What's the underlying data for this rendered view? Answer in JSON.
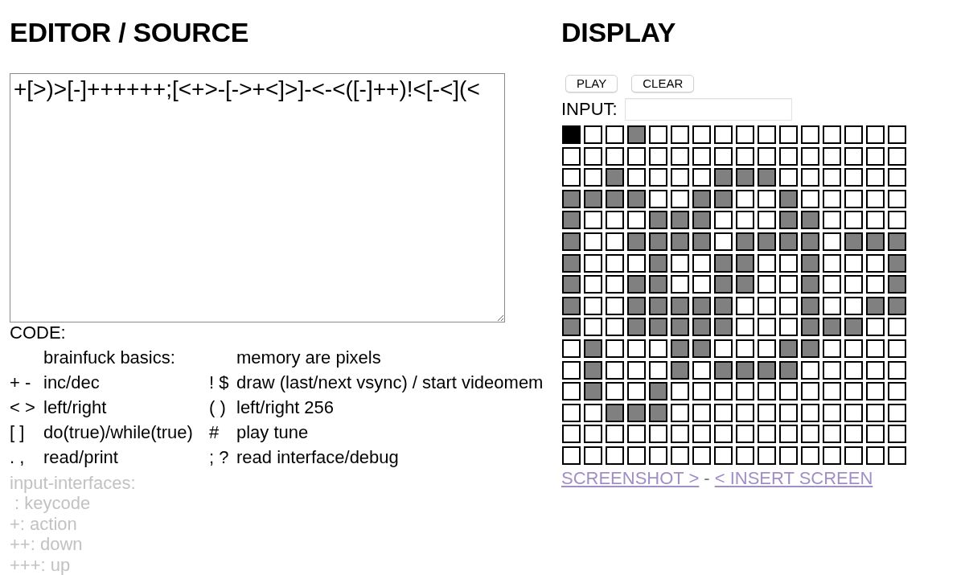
{
  "editor": {
    "title": "EDITOR / SOURCE",
    "source": "+[>)>[-]++++++;[<+>-[->+<]>]-<-<([-]++)!<[-<](<",
    "code_label": "CODE:",
    "reference": [
      {
        "left": {
          "text": "brainfuck basics:"
        },
        "right": {
          "text": "memory are pixels"
        }
      },
      {
        "left": {
          "keys": "+ -",
          "text": "inc/dec"
        },
        "right": {
          "keys": "! $",
          "text": "draw (last/next vsync) / start videomem"
        }
      },
      {
        "left": {
          "keys": "< >",
          "text": "left/right"
        },
        "right": {
          "keys": "( )",
          "text": "left/right 256"
        }
      },
      {
        "left": {
          "keys": "[ ]",
          "text": "do(true)/while(true)"
        },
        "right": {
          "keys": "#",
          "text": "play tune"
        }
      },
      {
        "left": {
          "keys": ". ,",
          "text": "read/print"
        },
        "right": {
          "keys": "; ?",
          "text": "read interface/debug"
        }
      }
    ],
    "input_interfaces": {
      "heading": "input-interfaces:",
      "items": [
        " : keycode",
        "+: action",
        "++: down",
        "+++: up"
      ]
    }
  },
  "display": {
    "title": "DISPLAY",
    "buttons": [
      "PLAY",
      "CLEAR"
    ],
    "input": {
      "label": "INPUT:"
    },
    "pixels": [
      [
        {
          "color": "#000000"
        },
        {
          "color": "#ffffff"
        },
        {
          "color": "#ffffff"
        },
        {
          "color": "#808080"
        },
        {
          "color": "#ffffff"
        },
        {
          "color": "#ffffff"
        },
        {
          "color": "#ffffff"
        },
        {
          "color": "#ffffff"
        },
        {
          "color": "#ffffff"
        },
        {
          "color": "#ffffff"
        },
        {
          "color": "#ffffff"
        },
        {
          "color": "#ffffff"
        },
        {
          "color": "#ffffff"
        },
        {
          "color": "#ffffff"
        },
        {
          "color": "#ffffff"
        },
        {
          "color": "#ffffff"
        }
      ],
      [
        {
          "color": "#ffffff"
        },
        {
          "color": "#ffffff"
        },
        {
          "color": "#ffffff"
        },
        {
          "color": "#ffffff"
        },
        {
          "color": "#ffffff"
        },
        {
          "color": "#ffffff"
        },
        {
          "color": "#ffffff"
        },
        {
          "color": "#ffffff"
        },
        {
          "color": "#ffffff"
        },
        {
          "color": "#ffffff"
        },
        {
          "color": "#ffffff"
        },
        {
          "color": "#ffffff"
        },
        {
          "color": "#ffffff"
        },
        {
          "color": "#ffffff"
        },
        {
          "color": "#ffffff"
        },
        {
          "color": "#ffffff"
        }
      ],
      [
        {
          "color": "#ffffff"
        },
        {
          "color": "#ffffff"
        },
        {
          "color": "#808080"
        },
        {
          "color": "#ffffff"
        },
        {
          "color": "#ffffff"
        },
        {
          "color": "#ffffff"
        },
        {
          "color": "#ffffff"
        },
        {
          "color": "#808080"
        },
        {
          "color": "#808080"
        },
        {
          "color": "#808080"
        },
        {
          "color": "#ffffff"
        },
        {
          "color": "#ffffff"
        },
        {
          "color": "#ffffff"
        },
        {
          "color": "#ffffff"
        },
        {
          "color": "#ffffff"
        },
        {
          "color": "#ffffff"
        }
      ],
      [
        {
          "color": "#808080"
        },
        {
          "color": "#808080"
        },
        {
          "color": "#808080"
        },
        {
          "color": "#808080"
        },
        {
          "color": "#ffffff"
        },
        {
          "color": "#ffffff"
        },
        {
          "color": "#808080"
        },
        {
          "color": "#808080"
        },
        {
          "color": "#ffffff"
        },
        {
          "color": "#ffffff"
        },
        {
          "color": "#808080"
        },
        {
          "color": "#ffffff"
        },
        {
          "color": "#ffffff"
        },
        {
          "color": "#ffffff"
        },
        {
          "color": "#ffffff"
        },
        {
          "color": "#ffffff"
        }
      ],
      [
        {
          "color": "#808080"
        },
        {
          "color": "#ffffff"
        },
        {
          "color": "#ffffff"
        },
        {
          "color": "#ffffff"
        },
        {
          "color": "#808080"
        },
        {
          "color": "#808080"
        },
        {
          "color": "#808080"
        },
        {
          "color": "#ffffff"
        },
        {
          "color": "#ffffff"
        },
        {
          "color": "#ffffff"
        },
        {
          "color": "#808080"
        },
        {
          "color": "#808080"
        },
        {
          "color": "#ffffff"
        },
        {
          "color": "#ffffff"
        },
        {
          "color": "#ffffff"
        },
        {
          "color": "#ffffff"
        }
      ],
      [
        {
          "color": "#808080"
        },
        {
          "color": "#ffffff"
        },
        {
          "color": "#ffffff"
        },
        {
          "color": "#808080"
        },
        {
          "color": "#808080"
        },
        {
          "color": "#808080"
        },
        {
          "color": "#808080"
        },
        {
          "color": "#ffffff"
        },
        {
          "color": "#808080"
        },
        {
          "color": "#808080"
        },
        {
          "color": "#808080"
        },
        {
          "color": "#808080"
        },
        {
          "color": "#ffffff"
        },
        {
          "color": "#808080"
        },
        {
          "color": "#808080"
        },
        {
          "color": "#808080"
        }
      ],
      [
        {
          "color": "#808080"
        },
        {
          "color": "#ffffff"
        },
        {
          "color": "#ffffff"
        },
        {
          "color": "#ffffff"
        },
        {
          "color": "#808080"
        },
        {
          "color": "#ffffff"
        },
        {
          "color": "#ffffff"
        },
        {
          "color": "#808080"
        },
        {
          "color": "#808080"
        },
        {
          "color": "#ffffff"
        },
        {
          "color": "#ffffff"
        },
        {
          "color": "#808080"
        },
        {
          "color": "#ffffff"
        },
        {
          "color": "#ffffff"
        },
        {
          "color": "#ffffff"
        },
        {
          "color": "#808080"
        }
      ],
      [
        {
          "color": "#808080"
        },
        {
          "color": "#ffffff"
        },
        {
          "color": "#ffffff"
        },
        {
          "color": "#808080"
        },
        {
          "color": "#808080"
        },
        {
          "color": "#ffffff"
        },
        {
          "color": "#ffffff"
        },
        {
          "color": "#808080"
        },
        {
          "color": "#808080"
        },
        {
          "color": "#ffffff"
        },
        {
          "color": "#ffffff"
        },
        {
          "color": "#808080"
        },
        {
          "color": "#ffffff"
        },
        {
          "color": "#ffffff"
        },
        {
          "color": "#ffffff"
        },
        {
          "color": "#808080"
        }
      ],
      [
        {
          "color": "#808080"
        },
        {
          "color": "#ffffff"
        },
        {
          "color": "#ffffff"
        },
        {
          "color": "#808080"
        },
        {
          "color": "#808080"
        },
        {
          "color": "#808080"
        },
        {
          "color": "#808080"
        },
        {
          "color": "#808080"
        },
        {
          "color": "#ffffff"
        },
        {
          "color": "#ffffff"
        },
        {
          "color": "#ffffff"
        },
        {
          "color": "#808080"
        },
        {
          "color": "#ffffff"
        },
        {
          "color": "#ffffff"
        },
        {
          "color": "#808080"
        },
        {
          "color": "#808080"
        }
      ],
      [
        {
          "color": "#808080"
        },
        {
          "color": "#ffffff"
        },
        {
          "color": "#ffffff"
        },
        {
          "color": "#808080"
        },
        {
          "color": "#808080"
        },
        {
          "color": "#808080"
        },
        {
          "color": "#808080"
        },
        {
          "color": "#808080"
        },
        {
          "color": "#ffffff"
        },
        {
          "color": "#ffffff"
        },
        {
          "color": "#ffffff"
        },
        {
          "color": "#808080"
        },
        {
          "color": "#808080"
        },
        {
          "color": "#808080"
        },
        {
          "color": "#ffffff"
        },
        {
          "color": "#ffffff"
        }
      ],
      [
        {
          "color": "#ffffff"
        },
        {
          "color": "#808080"
        },
        {
          "color": "#ffffff"
        },
        {
          "color": "#ffffff"
        },
        {
          "color": "#ffffff"
        },
        {
          "color": "#808080"
        },
        {
          "color": "#808080"
        },
        {
          "color": "#ffffff"
        },
        {
          "color": "#ffffff"
        },
        {
          "color": "#ffffff"
        },
        {
          "color": "#808080"
        },
        {
          "color": "#808080"
        },
        {
          "color": "#ffffff"
        },
        {
          "color": "#ffffff"
        },
        {
          "color": "#ffffff"
        },
        {
          "color": "#ffffff"
        }
      ],
      [
        {
          "color": "#ffffff"
        },
        {
          "color": "#808080"
        },
        {
          "color": "#ffffff"
        },
        {
          "color": "#ffffff"
        },
        {
          "color": "#ffffff"
        },
        {
          "color": "#808080"
        },
        {
          "color": "#ffffff"
        },
        {
          "color": "#808080"
        },
        {
          "color": "#808080"
        },
        {
          "color": "#808080"
        },
        {
          "color": "#808080"
        },
        {
          "color": "#ffffff"
        },
        {
          "color": "#ffffff"
        },
        {
          "color": "#ffffff"
        },
        {
          "color": "#ffffff"
        },
        {
          "color": "#ffffff"
        }
      ],
      [
        {
          "color": "#ffffff"
        },
        {
          "color": "#808080"
        },
        {
          "color": "#ffffff"
        },
        {
          "color": "#ffffff"
        },
        {
          "color": "#808080"
        },
        {
          "color": "#ffffff"
        },
        {
          "color": "#ffffff"
        },
        {
          "color": "#ffffff"
        },
        {
          "color": "#ffffff"
        },
        {
          "color": "#ffffff"
        },
        {
          "color": "#ffffff"
        },
        {
          "color": "#ffffff"
        },
        {
          "color": "#ffffff"
        },
        {
          "color": "#ffffff"
        },
        {
          "color": "#ffffff"
        },
        {
          "color": "#ffffff"
        }
      ],
      [
        {
          "color": "#ffffff"
        },
        {
          "color": "#ffffff"
        },
        {
          "color": "#808080"
        },
        {
          "color": "#808080"
        },
        {
          "color": "#808080"
        },
        {
          "color": "#ffffff"
        },
        {
          "color": "#ffffff"
        },
        {
          "color": "#ffffff"
        },
        {
          "color": "#ffffff"
        },
        {
          "color": "#ffffff"
        },
        {
          "color": "#ffffff"
        },
        {
          "color": "#ffffff"
        },
        {
          "color": "#ffffff"
        },
        {
          "color": "#ffffff"
        },
        {
          "color": "#ffffff"
        },
        {
          "color": "#ffffff"
        }
      ],
      [
        {
          "color": "#ffffff"
        },
        {
          "color": "#ffffff"
        },
        {
          "color": "#ffffff"
        },
        {
          "color": "#ffffff"
        },
        {
          "color": "#ffffff"
        },
        {
          "color": "#ffffff"
        },
        {
          "color": "#ffffff"
        },
        {
          "color": "#ffffff"
        },
        {
          "color": "#ffffff"
        },
        {
          "color": "#ffffff"
        },
        {
          "color": "#ffffff"
        },
        {
          "color": "#ffffff"
        },
        {
          "color": "#ffffff"
        },
        {
          "color": "#ffffff"
        },
        {
          "color": "#ffffff"
        },
        {
          "color": "#ffffff"
        }
      ],
      [
        {
          "color": "#ffffff"
        },
        {
          "color": "#ffffff"
        },
        {
          "color": "#ffffff"
        },
        {
          "color": "#ffffff"
        },
        {
          "color": "#ffffff"
        },
        {
          "color": "#ffffff"
        },
        {
          "color": "#ffffff"
        },
        {
          "color": "#ffffff"
        },
        {
          "color": "#ffffff"
        },
        {
          "color": "#ffffff"
        },
        {
          "color": "#ffffff"
        },
        {
          "color": "#ffffff"
        },
        {
          "color": "#ffffff"
        },
        {
          "color": "#ffffff"
        },
        {
          "color": "#ffffff"
        },
        {
          "color": "#ffffff"
        }
      ]
    ],
    "links": [
      "SCREENSHOT >",
      "< INSERT SCREEN"
    ],
    "link_separator": "-"
  }
}
